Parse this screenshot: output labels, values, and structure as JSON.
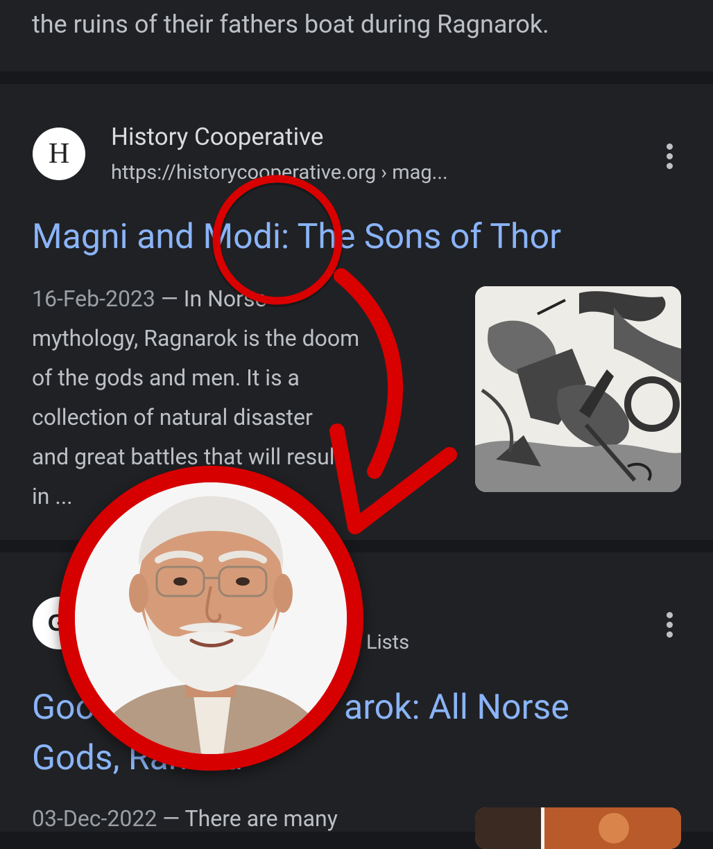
{
  "previous_result": {
    "snippet_tail": "the ruins of their fathers boat during Ragnarok."
  },
  "results": [
    {
      "favicon_letter": "H",
      "site_name": "History Cooperative",
      "url": "https://historycooperative.org › mag...",
      "title": "Magni and Modi: The Sons of Thor",
      "date": "16-Feb-2023",
      "snippet_lines": [
        "mythology, Ragnarok is the doom",
        "of the gods and men. It is a",
        "collection of natural disaster",
        "and great battles that will result",
        "in ..."
      ],
      "snippet_first": "— In Norse",
      "thumbnail": "norse-battle-engraving",
      "menu_icon": "more-vert-icon"
    },
    {
      "favicon_letter": "G",
      "url_tail": "Lists",
      "title_line1_start": "Goo",
      "title_line1_end": "arok: All Norse",
      "title_line2_start": "Gods, ",
      "title_line2_partial": "Ranked",
      "date": "03-Dec-2022",
      "snippet_first": "— There are many",
      "thumbnail": "norse-gods-image",
      "menu_icon": "more-vert-icon"
    }
  ],
  "annotation": {
    "highlight_color": "#d90000",
    "circled_word": "Modi",
    "arrow": "curved-arrow-down-left",
    "portrait": "man-with-white-beard-and-glasses"
  },
  "colors": {
    "background": "#17181b",
    "card": "#202124",
    "link": "#8ab4f8",
    "text": "#bdc1c6"
  }
}
